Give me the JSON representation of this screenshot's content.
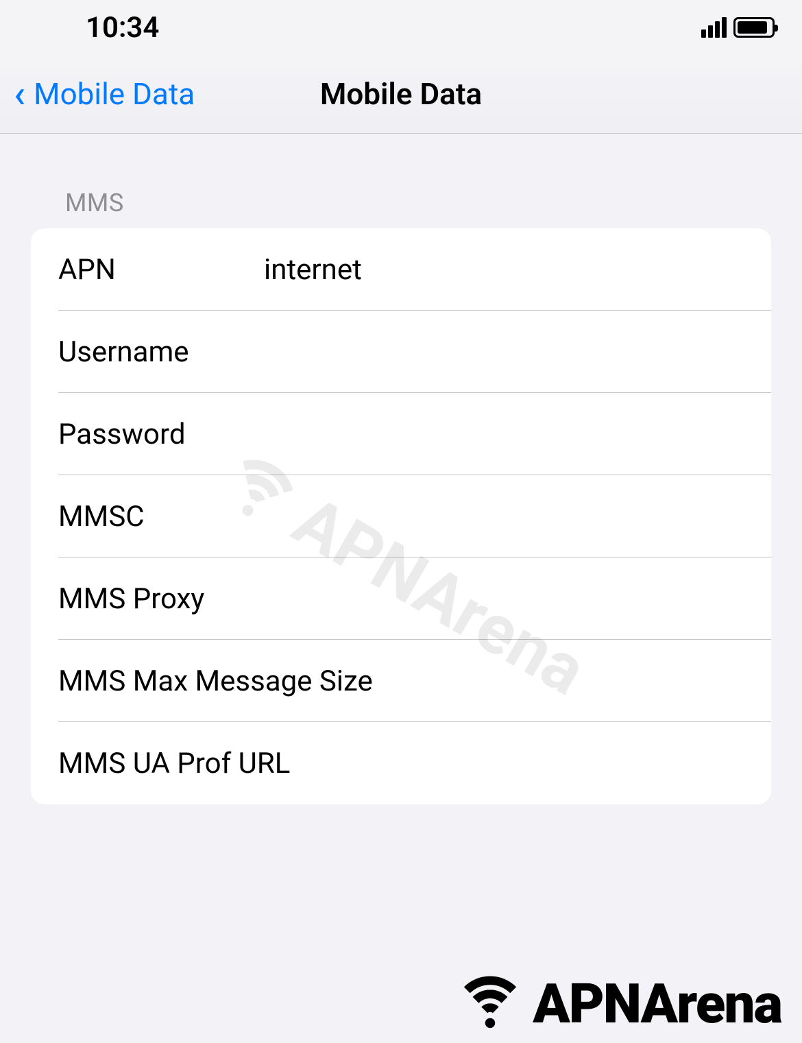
{
  "status": {
    "time": "10:34"
  },
  "nav": {
    "back_label": "Mobile Data",
    "title": "Mobile Data"
  },
  "section": {
    "header": "MMS",
    "fields": {
      "apn": {
        "label": "APN",
        "value": "internet"
      },
      "username": {
        "label": "Username",
        "value": ""
      },
      "password": {
        "label": "Password",
        "value": ""
      },
      "mmsc": {
        "label": "MMSC",
        "value": ""
      },
      "mms_proxy": {
        "label": "MMS Proxy",
        "value": ""
      },
      "mms_max": {
        "label": "MMS Max Message Size",
        "value": ""
      },
      "mms_ua": {
        "label": "MMS UA Prof URL",
        "value": ""
      }
    }
  },
  "watermark": {
    "text": "APNArena"
  },
  "footer": {
    "text": "APNArena"
  }
}
